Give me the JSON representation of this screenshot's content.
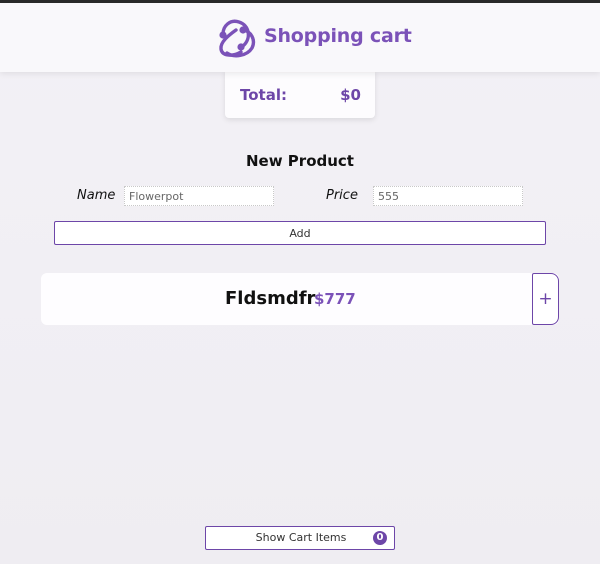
{
  "header": {
    "title": "Shopping cart",
    "logo_icon": "redux-logo-icon",
    "accent_color": "#7b52b8"
  },
  "total": {
    "label": "Total:",
    "value": "$0"
  },
  "new_product": {
    "heading": "New Product",
    "name_label": "Name",
    "name_value": "Flowerpot",
    "price_label": "Price",
    "price_value": "555",
    "add_label": "Add"
  },
  "products": [
    {
      "name": "Fldsmdfr",
      "price": "$777",
      "add_label": "+"
    }
  ],
  "cart": {
    "show_label": "Show Cart Items",
    "count": "0"
  }
}
